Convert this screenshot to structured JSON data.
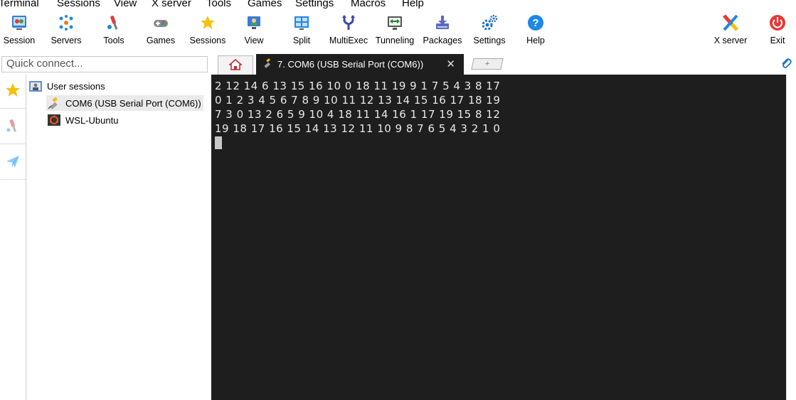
{
  "menu": [
    "Terminal",
    "Sessions",
    "View",
    "X server",
    "Tools",
    "Games",
    "Settings",
    "Macros",
    "Help"
  ],
  "toolbar": {
    "session": "Session",
    "servers": "Servers",
    "tools": "Tools",
    "games": "Games",
    "sessions": "Sessions",
    "view": "View",
    "split": "Split",
    "multiexec": "MultiExec",
    "tunneling": "Tunneling",
    "packages": "Packages",
    "settings": "Settings",
    "help": "Help",
    "xserver": "X server",
    "exit": "Exit"
  },
  "quick_connect": {
    "placeholder": "Quick connect..."
  },
  "tabs": {
    "active_title": "7. COM6  (USB Serial Port (COM6))",
    "close": "✕",
    "add": "+"
  },
  "tree": {
    "root": "User sessions",
    "items": [
      "COM6  (USB Serial Port (COM6))",
      "WSL-Ubuntu"
    ]
  },
  "terminal": {
    "lines": [
      "2 12 14 6 13 15 16 10 0 18 11 19 9 1 7 5 4 3 8 17",
      "0 1 2 3 4 5 6 7 8 9 10 11 12 13 14 15 16 17 18 19",
      "7 3 0 13 2 6 5 9 10 4 18 11 14 16 1 17 19 15 8 12",
      "19 18 17 16 15 14 13 12 11 10 9 8 7 6 5 4 3 2 1 0"
    ]
  },
  "colors": {
    "terminal_bg": "#1e1e1e",
    "terminal_fg": "#e8e8e8",
    "accent_blue": "#1e73c8"
  }
}
